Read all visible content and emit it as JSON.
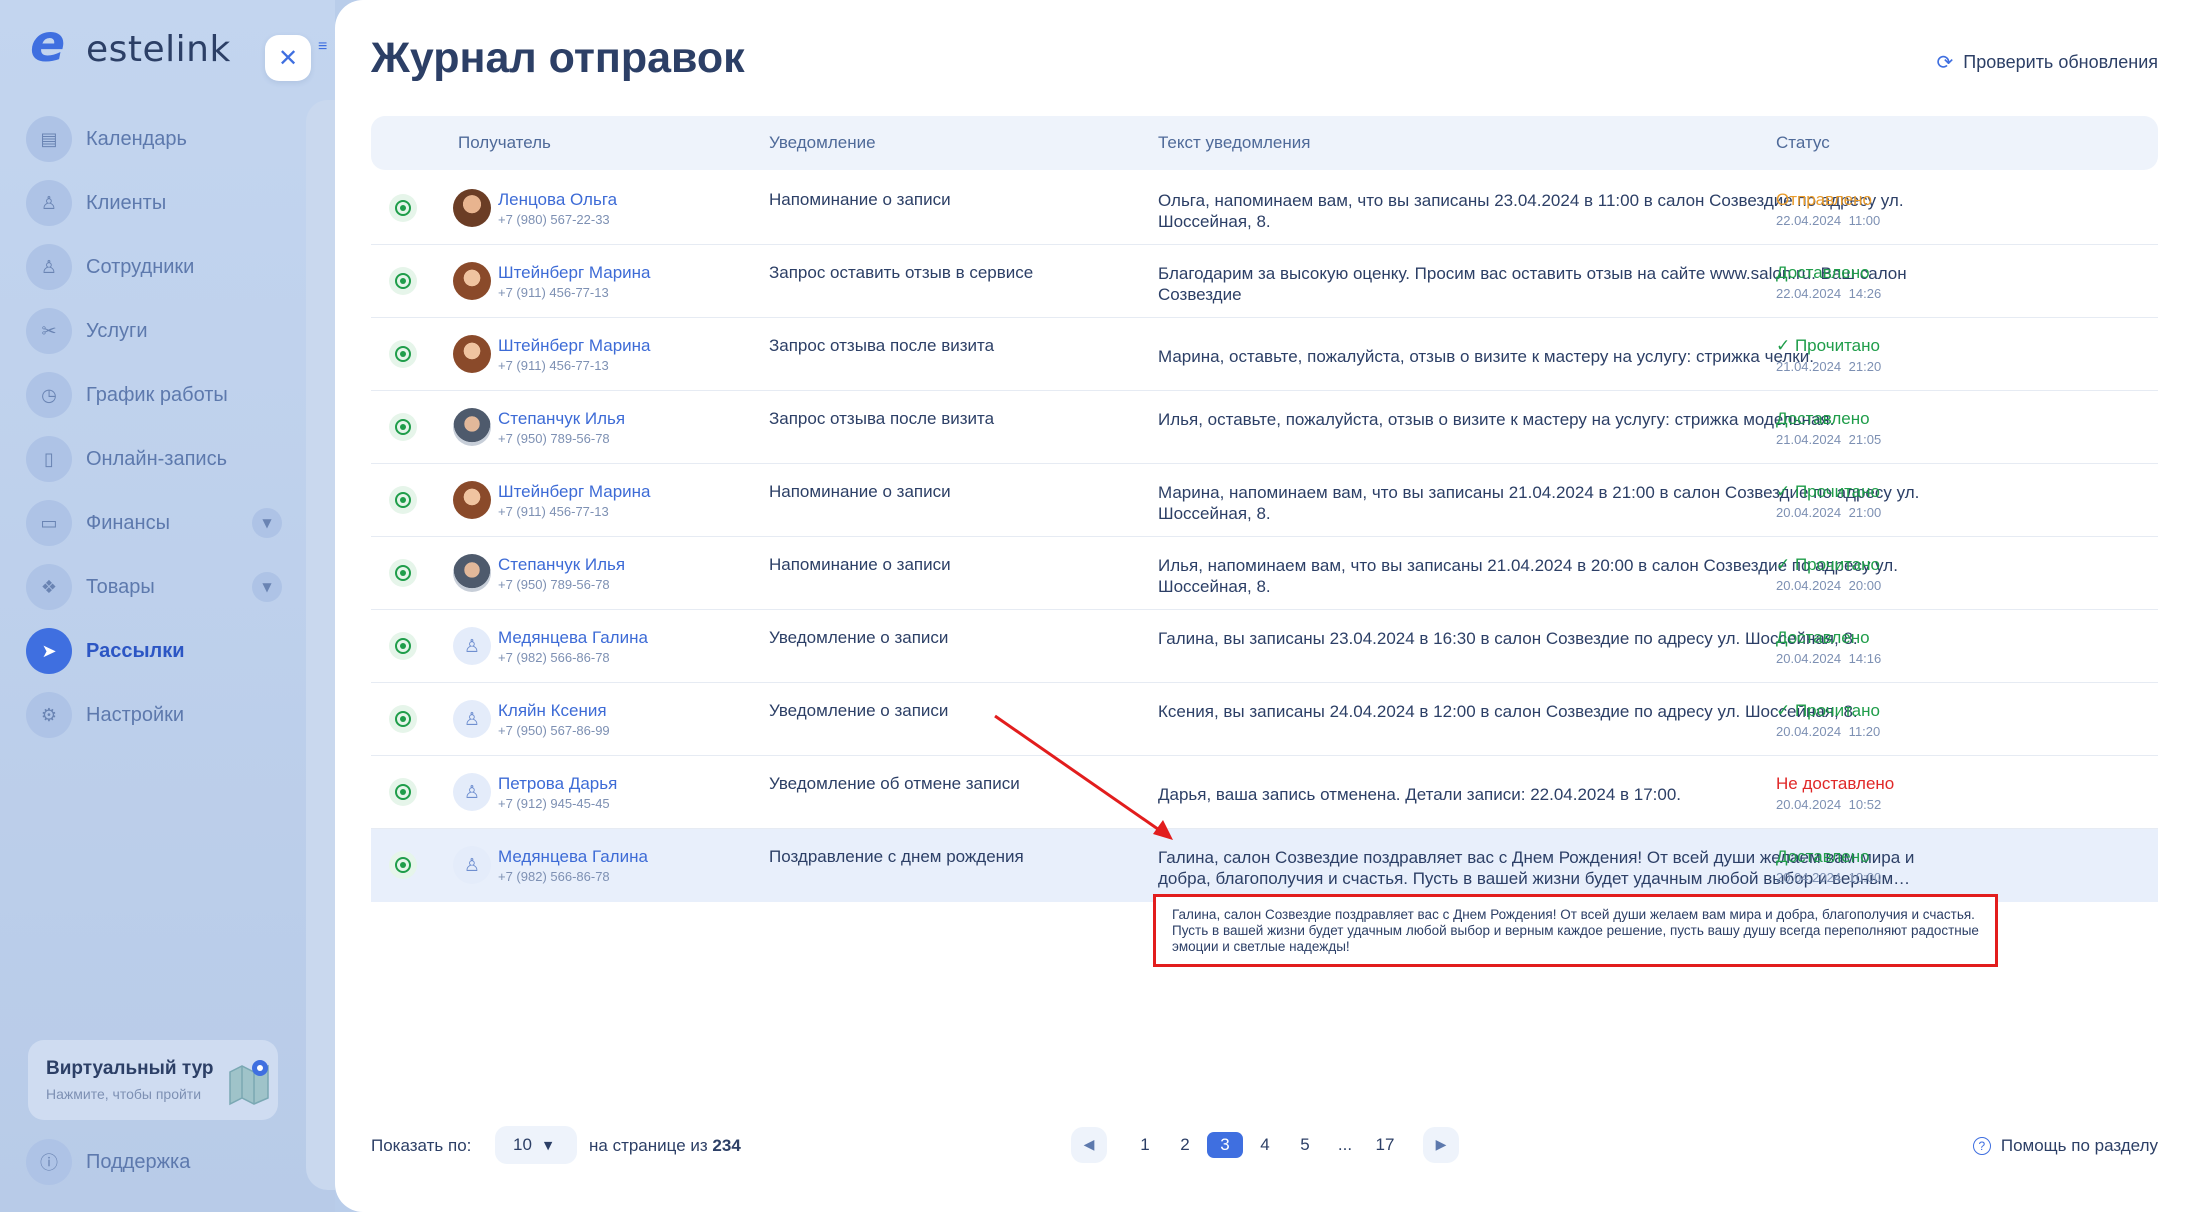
{
  "brand": {
    "name": "estelink",
    "mark": "e"
  },
  "sidebar": {
    "items": [
      {
        "label": "Календарь",
        "icon": "calendar-icon",
        "glyph": "▤"
      },
      {
        "label": "Клиенты",
        "icon": "clients-icon",
        "glyph": "♙"
      },
      {
        "label": "Сотрудники",
        "icon": "user-icon",
        "glyph": "♙"
      },
      {
        "label": "Услуги",
        "icon": "scissors-icon",
        "glyph": "✂"
      },
      {
        "label": "График работы",
        "icon": "clock-icon",
        "glyph": "◷"
      },
      {
        "label": "Онлайн-запись",
        "icon": "phone-icon",
        "glyph": "▯"
      },
      {
        "label": "Финансы",
        "icon": "wallet-icon",
        "glyph": "▭"
      },
      {
        "label": "Товары",
        "icon": "box-icon",
        "glyph": "❖"
      },
      {
        "label": "Рассылки",
        "icon": "send-icon",
        "glyph": "➤"
      },
      {
        "label": "Настройки",
        "icon": "gear-icon",
        "glyph": "⚙"
      }
    ],
    "tour": {
      "title": "Виртуальный тур",
      "subtitle": "Нажмите, чтобы пройти"
    },
    "support": {
      "label": "Поддержка",
      "glyph": "ⓘ"
    }
  },
  "page": {
    "title": "Журнал отправок",
    "refresh_label": "Проверить обновления"
  },
  "table": {
    "headers": {
      "recipient": "Получатель",
      "notification": "Уведомление",
      "text": "Текст уведомления",
      "status": "Статус"
    },
    "rows": [
      {
        "name": "Ленцова Ольга",
        "phone": "+7 (980) 567-22-33",
        "notification": "Напоминание о записи",
        "text": "Ольга, напоминаем вам, что вы записаны 23.04.2024 в 11:00 в салон Созвездие по адресу ул. Шоссейная, 8.",
        "status": "Отправлено",
        "date": "22.04.2024 11:00"
      },
      {
        "name": "Штейнберг Марина",
        "phone": "+7 (911) 456-77-13",
        "notification": "Запрос оставить отзыв в сервисе",
        "text": "Благодарим за высокую оценку. Просим вас оставить отзыв на сайте www.salon.ru. Ваш салон Созвездие",
        "status": "Доставлено",
        "date": "22.04.2024 14:26"
      },
      {
        "name": "Штейнберг Марина",
        "phone": "+7 (911) 456-77-13",
        "notification": "Запрос отзыва после визита",
        "text": "Марина, оставьте, пожалуйста, отзыв о визите к мастеру на услугу: стрижка челки.",
        "status": "✓ Прочитано",
        "date": "21.04.2024 21:20"
      },
      {
        "name": "Степанчук Илья",
        "phone": "+7 (950) 789-56-78",
        "notification": "Запрос отзыва после визита",
        "text": "Илья, оставьте, пожалуйста, отзыв о визите к мастеру на услугу: стрижка модельная.",
        "status": "Доставлено",
        "date": "21.04.2024 21:05"
      },
      {
        "name": "Штейнберг Марина",
        "phone": "+7 (911) 456-77-13",
        "notification": "Напоминание о записи",
        "text": "Марина, напоминаем вам, что вы записаны 21.04.2024 в 21:00 в салон Созвездие по адресу ул. Шоссейная, 8.",
        "status": "✓ Прочитано",
        "date": "20.04.2024 21:00"
      },
      {
        "name": "Степанчук Илья",
        "phone": "+7 (950) 789-56-78",
        "notification": "Напоминание о записи",
        "text": "Илья, напоминаем вам, что вы записаны 21.04.2024 в 20:00 в салон Созвездие по адресу ул. Шоссейная, 8.",
        "status": "✓ Прочитано",
        "date": "20.04.2024 20:00"
      },
      {
        "name": "Медянцева Галина",
        "phone": "+7 (982) 566-86-78",
        "notification": "Уведомление о записи",
        "text": "Галина, вы записаны 23.04.2024 в 16:30 в салон Созвездие по адресу ул. Шоссейная, 8.",
        "status": "Доставлено",
        "date": "20.04.2024 14:16"
      },
      {
        "name": "Кляйн Ксения",
        "phone": "+7 (950) 567-86-99",
        "notification": "Уведомление о записи",
        "text": "Ксения, вы записаны 24.04.2024 в 12:00 в салон Созвездие по адресу ул. Шоссейная, 8.",
        "status": "✓ Прочитано",
        "date": "20.04.2024 11:20"
      },
      {
        "name": "Петрова Дарья",
        "phone": "+7 (912) 945-45-45",
        "notification": "Уведомление об отмене записи",
        "text": "Дарья, ваша запись отменена. Детали записи: 22.04.2024 в 17:00.",
        "status": "Не доставлено",
        "date": "20.04.2024 10:52"
      },
      {
        "name": "Медянцева Галина",
        "phone": "+7 (982) 566-86-78",
        "notification": "Поздравление с днем рождения",
        "text": "Галина, салон Созвездие поздравляет вас с Днем Рождения! От всей души желаем вам мира и добра, благополучия и счастья. Пусть в вашей жизни будет удачным любой выбор и верным…",
        "status": "Доставлено",
        "date": "20.04.2024 10:00"
      }
    ]
  },
  "tooltip": {
    "text": "Галина, салон Созвездие поздравляет вас с Днем Рождения! От всей души желаем вам мира и добра, благополучия и счастья. Пусть в вашей жизни будет удачным любой выбор и верным каждое решение, пусть вашу душу всегда переполняют радостные эмоции и светлые надежды!"
  },
  "footer": {
    "per_page_label": "Показать по:",
    "per_page_value": "10",
    "of_label": "на странице из",
    "total": "234",
    "pages": [
      "1",
      "2",
      "3",
      "4",
      "5",
      "...",
      "17"
    ],
    "current_page": "3",
    "help_label": "Помощь по разделу"
  },
  "colors": {
    "accent": "#3f6fe0",
    "sent": "#e89a2a",
    "delivered": "#1f9d4a",
    "failed": "#e02828",
    "annotation": "#e21d1d"
  }
}
